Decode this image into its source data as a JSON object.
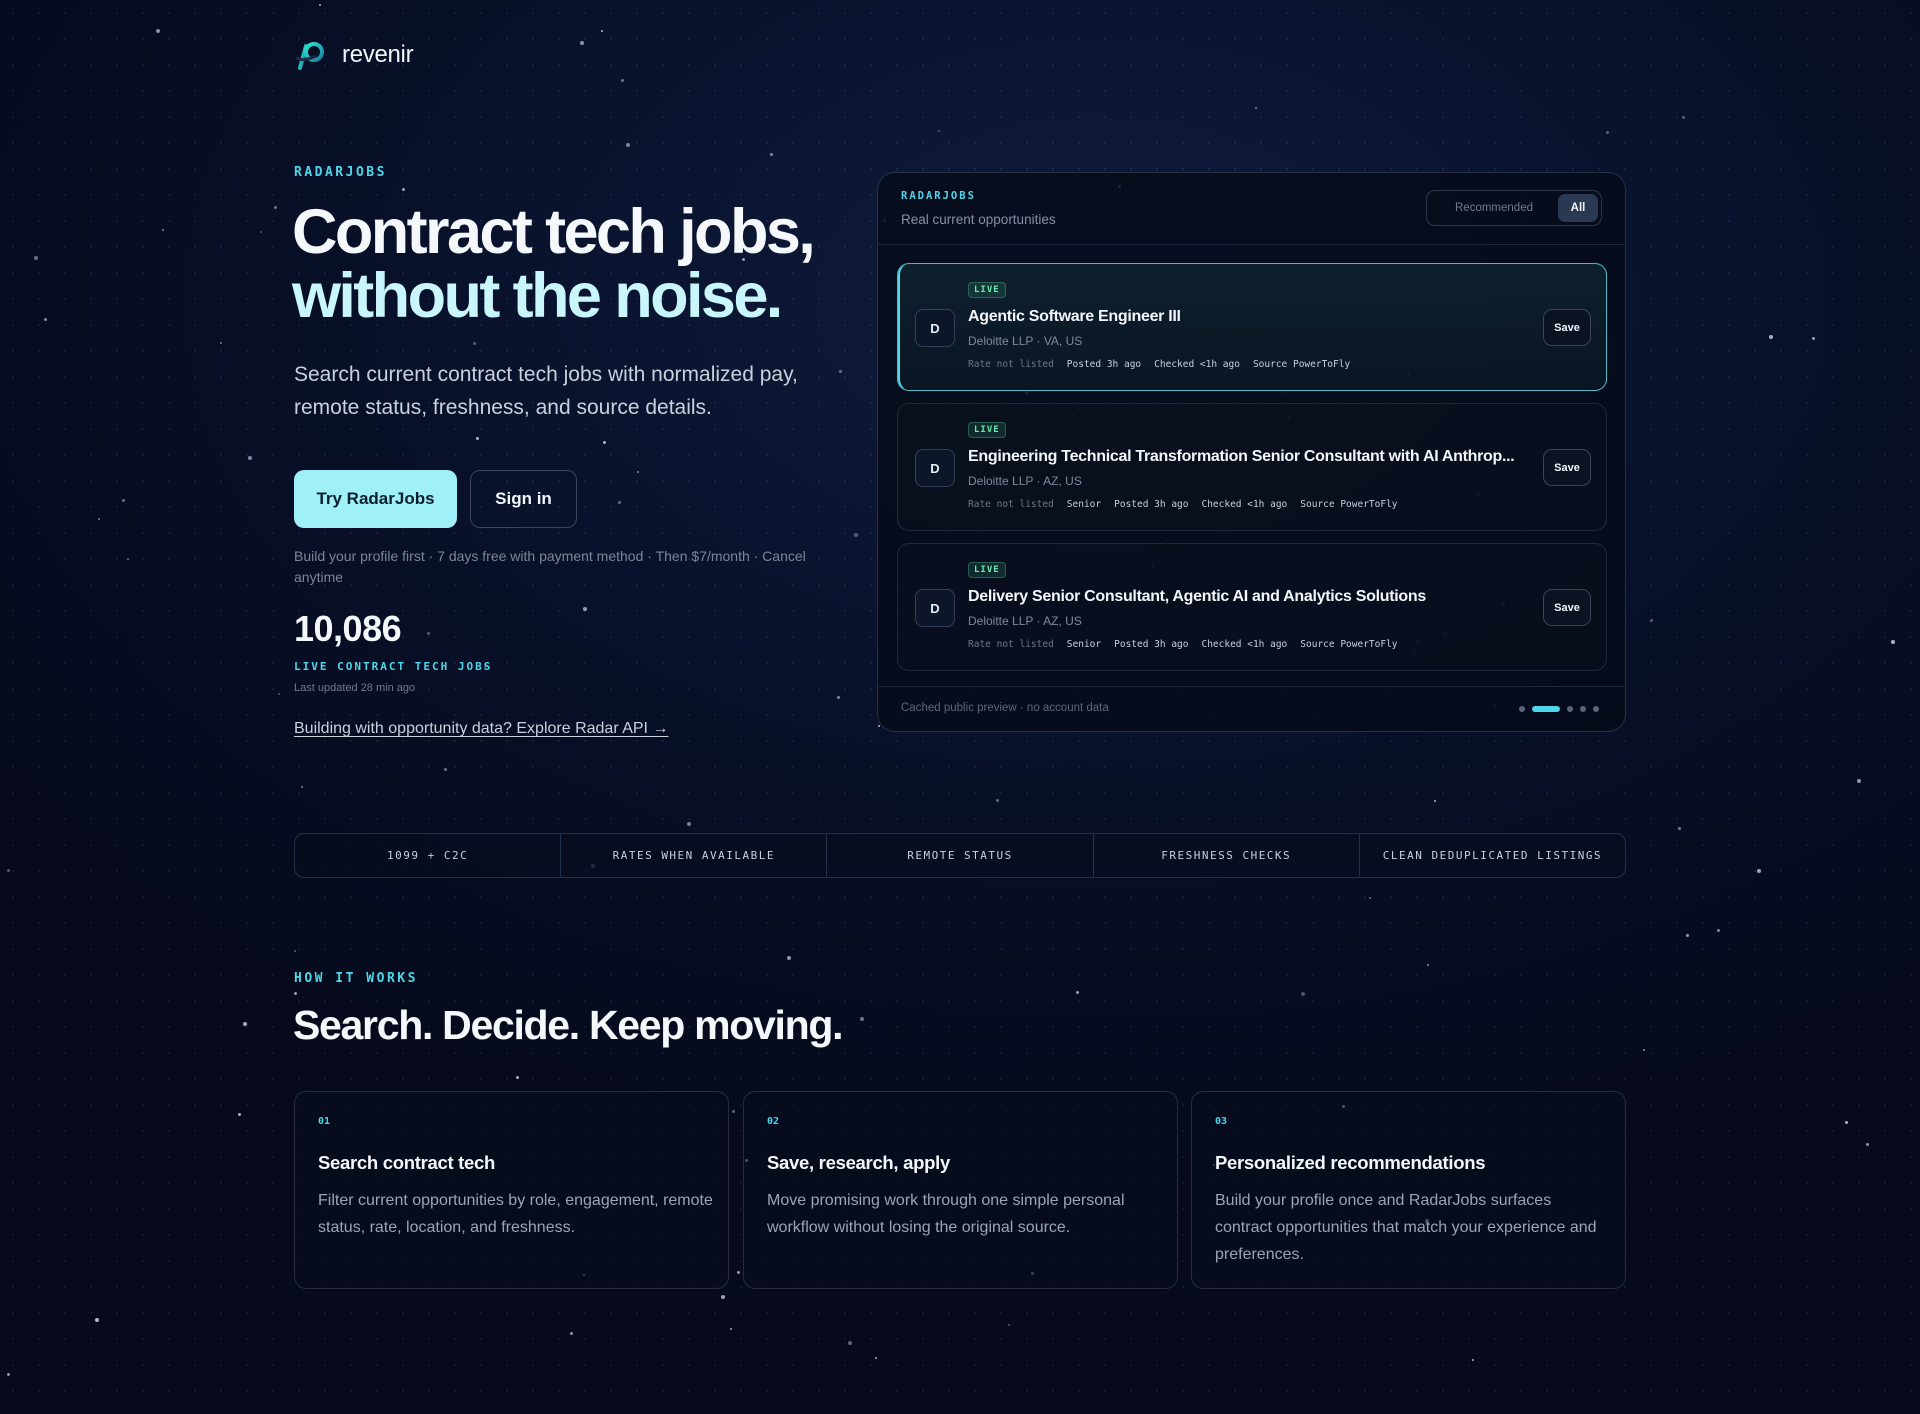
{
  "brand": {
    "name": "revenir"
  },
  "hero": {
    "eyebrow": "RADARJOBS",
    "title_line1": "Contract tech jobs,",
    "title_line2": "without the noise.",
    "subtitle": "Search current contract tech jobs with normalized pay, remote status, freshness, and source details.",
    "primary_cta": "Try RadarJobs",
    "secondary_cta": "Sign in",
    "fine_print": "Build your profile first · 7 days free with payment method · Then $7/month · Cancel anytime",
    "stat_value": "10,086",
    "stat_label": "LIVE CONTRACT TECH JOBS",
    "stat_updated": "Last updated 28 min ago",
    "api_link": "Building with opportunity data? Explore Radar API →"
  },
  "preview": {
    "eyebrow": "RADARJOBS",
    "subtitle": "Real current opportunities",
    "toggle": {
      "recommended": "Recommended",
      "all": "All"
    },
    "jobs": [
      {
        "avatar": "D",
        "badge": "LIVE",
        "title": "Agentic Software Engineer III",
        "company": "Deloitte LLP · VA, US",
        "rate": "Rate not listed",
        "level": "",
        "posted": "Posted 3h ago",
        "checked": "Checked <1h ago",
        "source": "Source PowerToFly",
        "save": "Save"
      },
      {
        "avatar": "D",
        "badge": "LIVE",
        "title": "Engineering Technical Transformation Senior Consultant with AI Anthrop...",
        "company": "Deloitte LLP · AZ, US",
        "rate": "Rate not listed",
        "level": "Senior",
        "posted": "Posted 3h ago",
        "checked": "Checked <1h ago",
        "source": "Source PowerToFly",
        "save": "Save"
      },
      {
        "avatar": "D",
        "badge": "LIVE",
        "title": "Delivery Senior Consultant, Agentic AI and Analytics Solutions",
        "company": "Deloitte LLP · AZ, US",
        "rate": "Rate not listed",
        "level": "Senior",
        "posted": "Posted 3h ago",
        "checked": "Checked <1h ago",
        "source": "Source PowerToFly",
        "save": "Save"
      }
    ],
    "footer": "Cached public preview · no account data",
    "pager": {
      "count": 5,
      "active": 2
    }
  },
  "features": [
    "1099 + C2C",
    "RATES WHEN AVAILABLE",
    "REMOTE STATUS",
    "FRESHNESS CHECKS",
    "CLEAN DEDUPLICATED LISTINGS"
  ],
  "how": {
    "eyebrow": "HOW IT WORKS",
    "title": "Search. Decide. Keep moving.",
    "cards": [
      {
        "num": "01",
        "title": "Search contract tech",
        "desc": "Filter current opportunities by role, engagement, remote status, rate, location, and freshness."
      },
      {
        "num": "02",
        "title": "Save, research, apply",
        "desc": "Move promising work through one simple personal workflow without losing the original source."
      },
      {
        "num": "03",
        "title": "Personalized recommendations",
        "desc": "Build your profile once and RadarJobs surfaces contract opportunities that match your experience and preferences."
      }
    ]
  },
  "colors": {
    "accent": "#4fd6e8",
    "cta": "#9ff0f7",
    "live": "#6ee7b0",
    "background": "#070d22"
  },
  "icons": {
    "logo": "revenir-logo-icon"
  }
}
